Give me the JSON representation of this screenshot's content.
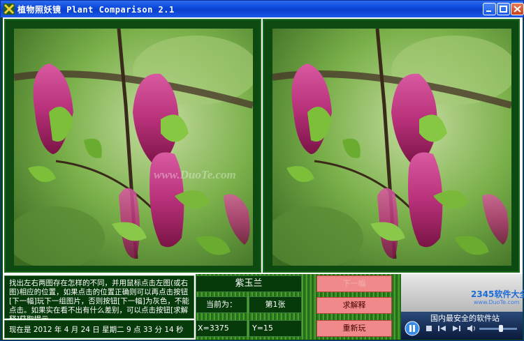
{
  "window": {
    "title": "植物照妖镜 Plant Comparison 2.1"
  },
  "instructions": "找出左右两图存在怎样的不同，并用鼠标点击左图(或右图)相应的位置，如果点击的位置正确则可以再点击按钮[下一幅]玩下一组图片，否则按钮[下一幅]为灰色，不能点击。如果实在看不出有什么差别，可以点击按钮[求解释]获取提示。",
  "datetime": "现在是 2012 年 4 月 24 日 星期二 9 点 33 分 14 秒",
  "plant_name": "紫玉兰",
  "current_label": "当前为：",
  "current_value": "第1张",
  "coord_x": "X=3375",
  "coord_y": "Y=15",
  "buttons": {
    "next": "下一幅",
    "hint": "求解释",
    "restart": "重新玩"
  },
  "watermark": "www.DuoTe.com",
  "media": {
    "overlay_text": "国内最安全的软件站",
    "brand": "2345软件大全",
    "brand_sub": "www.DuoTe.com"
  }
}
